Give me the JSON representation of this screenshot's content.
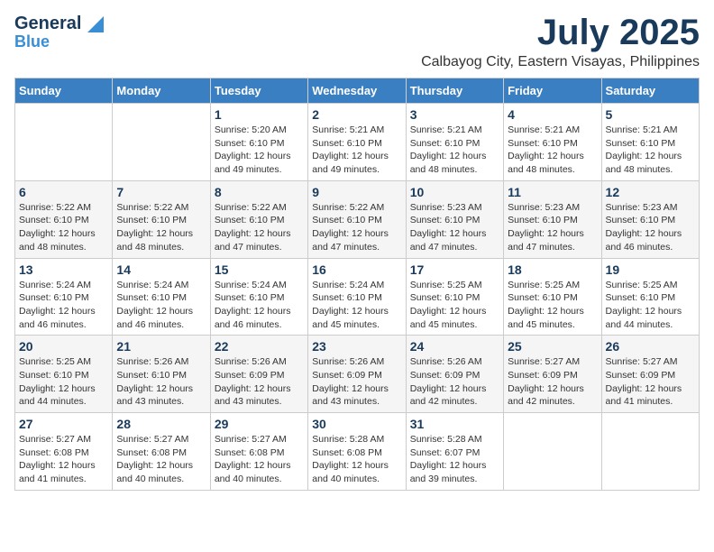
{
  "header": {
    "logo_general": "General",
    "logo_blue": "Blue",
    "main_title": "July 2025",
    "subtitle": "Calbayog City, Eastern Visayas, Philippines"
  },
  "calendar": {
    "days_of_week": [
      "Sunday",
      "Monday",
      "Tuesday",
      "Wednesday",
      "Thursday",
      "Friday",
      "Saturday"
    ],
    "weeks": [
      [
        {
          "day": "",
          "info": ""
        },
        {
          "day": "",
          "info": ""
        },
        {
          "day": "1",
          "info": "Sunrise: 5:20 AM\nSunset: 6:10 PM\nDaylight: 12 hours and 49 minutes."
        },
        {
          "day": "2",
          "info": "Sunrise: 5:21 AM\nSunset: 6:10 PM\nDaylight: 12 hours and 49 minutes."
        },
        {
          "day": "3",
          "info": "Sunrise: 5:21 AM\nSunset: 6:10 PM\nDaylight: 12 hours and 48 minutes."
        },
        {
          "day": "4",
          "info": "Sunrise: 5:21 AM\nSunset: 6:10 PM\nDaylight: 12 hours and 48 minutes."
        },
        {
          "day": "5",
          "info": "Sunrise: 5:21 AM\nSunset: 6:10 PM\nDaylight: 12 hours and 48 minutes."
        }
      ],
      [
        {
          "day": "6",
          "info": "Sunrise: 5:22 AM\nSunset: 6:10 PM\nDaylight: 12 hours and 48 minutes."
        },
        {
          "day": "7",
          "info": "Sunrise: 5:22 AM\nSunset: 6:10 PM\nDaylight: 12 hours and 48 minutes."
        },
        {
          "day": "8",
          "info": "Sunrise: 5:22 AM\nSunset: 6:10 PM\nDaylight: 12 hours and 47 minutes."
        },
        {
          "day": "9",
          "info": "Sunrise: 5:22 AM\nSunset: 6:10 PM\nDaylight: 12 hours and 47 minutes."
        },
        {
          "day": "10",
          "info": "Sunrise: 5:23 AM\nSunset: 6:10 PM\nDaylight: 12 hours and 47 minutes."
        },
        {
          "day": "11",
          "info": "Sunrise: 5:23 AM\nSunset: 6:10 PM\nDaylight: 12 hours and 47 minutes."
        },
        {
          "day": "12",
          "info": "Sunrise: 5:23 AM\nSunset: 6:10 PM\nDaylight: 12 hours and 46 minutes."
        }
      ],
      [
        {
          "day": "13",
          "info": "Sunrise: 5:24 AM\nSunset: 6:10 PM\nDaylight: 12 hours and 46 minutes."
        },
        {
          "day": "14",
          "info": "Sunrise: 5:24 AM\nSunset: 6:10 PM\nDaylight: 12 hours and 46 minutes."
        },
        {
          "day": "15",
          "info": "Sunrise: 5:24 AM\nSunset: 6:10 PM\nDaylight: 12 hours and 46 minutes."
        },
        {
          "day": "16",
          "info": "Sunrise: 5:24 AM\nSunset: 6:10 PM\nDaylight: 12 hours and 45 minutes."
        },
        {
          "day": "17",
          "info": "Sunrise: 5:25 AM\nSunset: 6:10 PM\nDaylight: 12 hours and 45 minutes."
        },
        {
          "day": "18",
          "info": "Sunrise: 5:25 AM\nSunset: 6:10 PM\nDaylight: 12 hours and 45 minutes."
        },
        {
          "day": "19",
          "info": "Sunrise: 5:25 AM\nSunset: 6:10 PM\nDaylight: 12 hours and 44 minutes."
        }
      ],
      [
        {
          "day": "20",
          "info": "Sunrise: 5:25 AM\nSunset: 6:10 PM\nDaylight: 12 hours and 44 minutes."
        },
        {
          "day": "21",
          "info": "Sunrise: 5:26 AM\nSunset: 6:10 PM\nDaylight: 12 hours and 43 minutes."
        },
        {
          "day": "22",
          "info": "Sunrise: 5:26 AM\nSunset: 6:09 PM\nDaylight: 12 hours and 43 minutes."
        },
        {
          "day": "23",
          "info": "Sunrise: 5:26 AM\nSunset: 6:09 PM\nDaylight: 12 hours and 43 minutes."
        },
        {
          "day": "24",
          "info": "Sunrise: 5:26 AM\nSunset: 6:09 PM\nDaylight: 12 hours and 42 minutes."
        },
        {
          "day": "25",
          "info": "Sunrise: 5:27 AM\nSunset: 6:09 PM\nDaylight: 12 hours and 42 minutes."
        },
        {
          "day": "26",
          "info": "Sunrise: 5:27 AM\nSunset: 6:09 PM\nDaylight: 12 hours and 41 minutes."
        }
      ],
      [
        {
          "day": "27",
          "info": "Sunrise: 5:27 AM\nSunset: 6:08 PM\nDaylight: 12 hours and 41 minutes."
        },
        {
          "day": "28",
          "info": "Sunrise: 5:27 AM\nSunset: 6:08 PM\nDaylight: 12 hours and 40 minutes."
        },
        {
          "day": "29",
          "info": "Sunrise: 5:27 AM\nSunset: 6:08 PM\nDaylight: 12 hours and 40 minutes."
        },
        {
          "day": "30",
          "info": "Sunrise: 5:28 AM\nSunset: 6:08 PM\nDaylight: 12 hours and 40 minutes."
        },
        {
          "day": "31",
          "info": "Sunrise: 5:28 AM\nSunset: 6:07 PM\nDaylight: 12 hours and 39 minutes."
        },
        {
          "day": "",
          "info": ""
        },
        {
          "day": "",
          "info": ""
        }
      ]
    ]
  }
}
